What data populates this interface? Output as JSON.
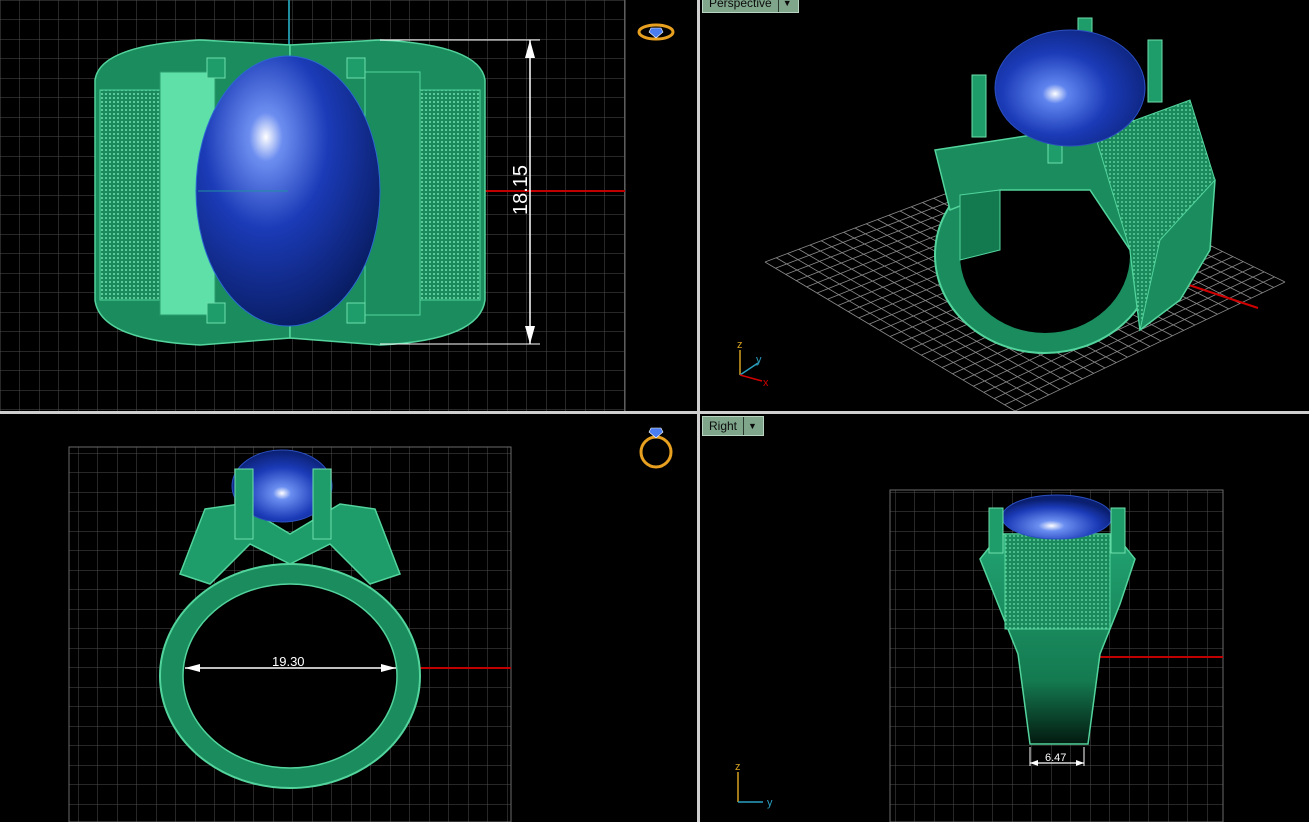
{
  "viewports": {
    "top": {
      "dimension": "18.15"
    },
    "perspective": {
      "label": "Perspective"
    },
    "front": {
      "dimension": "19.30"
    },
    "right": {
      "label": "Right",
      "dimension": "6.47"
    }
  },
  "axis_labels": {
    "x": "x",
    "y": "y",
    "z": "z"
  },
  "colors": {
    "background": "#000000",
    "grid": "#5a5a5a",
    "ring_metal": "#1e9c6a",
    "gem": "#1a37a8",
    "x_axis": "#c00000",
    "y_axis": "#1f8fa0",
    "dimension": "#ffffff",
    "tab": "#7fa58b"
  },
  "icons": [
    "ring-view-icon",
    "ring-front-icon",
    "viewport-menu-caret-icon"
  ]
}
